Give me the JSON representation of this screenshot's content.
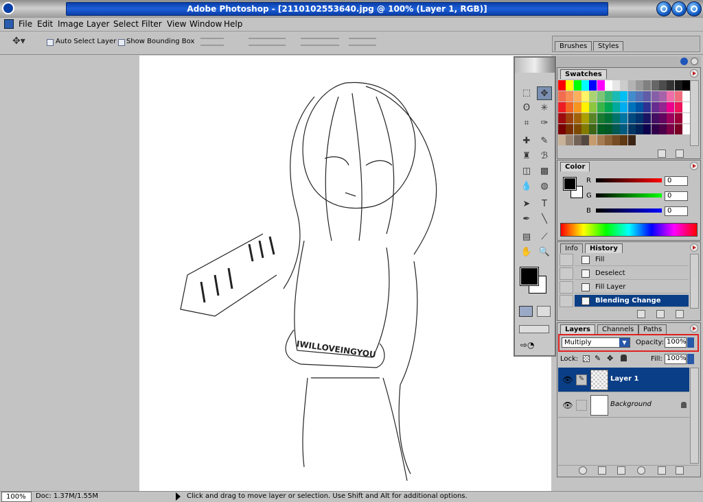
{
  "app": {
    "title": "Adobe Photoshop - [2110102553640.jpg @ 100% (Layer 1, RGB)]"
  },
  "menu": [
    "File",
    "Edit",
    "Image",
    "Layer",
    "Select",
    "Filter",
    "View",
    "Window",
    "Help"
  ],
  "options": {
    "auto_select": "Auto Select Layer",
    "bounding_box": "Show Bounding Box"
  },
  "palette_well": {
    "tabs": [
      "Brushes",
      "Styles"
    ]
  },
  "swatches": {
    "tab": "Swatches",
    "rows": [
      [
        "#ff0000",
        "#ffff00",
        "#00ff00",
        "#00ffff",
        "#0000ff",
        "#ff00ff",
        "#ffffff",
        "#e6e6e6",
        "#cccccc",
        "#b3b3b3",
        "#999999",
        "#808080",
        "#666666",
        "#4d4d4d",
        "#333333",
        "#1a1a1a",
        "#000000"
      ],
      [
        "#f26c4f",
        "#f68e55",
        "#fbaf5c",
        "#fff467",
        "#acd372",
        "#7cc576",
        "#3bb878",
        "#1abbb4",
        "#00bff3",
        "#438ccb",
        "#5574b9",
        "#605ca8",
        "#855fa8",
        "#a763a9",
        "#ef6ea8",
        "#f16d7e",
        "#ffffff"
      ],
      [
        "#ed1c24",
        "#f26522",
        "#f7941d",
        "#fff200",
        "#8dc63f",
        "#39b54a",
        "#00a651",
        "#00a99d",
        "#00aeef",
        "#0072bc",
        "#0054a6",
        "#2e3192",
        "#662d91",
        "#92278f",
        "#ec008c",
        "#ed145b",
        "#ffffff"
      ],
      [
        "#9e0b0f",
        "#a0410d",
        "#a3620a",
        "#aba000",
        "#598527",
        "#1a7b30",
        "#007236",
        "#00746b",
        "#0076a3",
        "#004a80",
        "#003471",
        "#1b1464",
        "#440e62",
        "#630460",
        "#9e005d",
        "#9e0039",
        "#ffffff"
      ],
      [
        "#790000",
        "#7b2e00",
        "#7d4900",
        "#827b00",
        "#406618",
        "#005e20",
        "#005826",
        "#005952",
        "#005b7f",
        "#003663",
        "#002157",
        "#0d004c",
        "#32004b",
        "#4b0049",
        "#7b0046",
        "#7a0026",
        "#ffffff"
      ],
      [
        "#c7b299",
        "#998675",
        "#736357",
        "#534741",
        "#c69c6d",
        "#a67c52",
        "#8c6239",
        "#754c24",
        "#603913",
        "#3c2415"
      ]
    ]
  },
  "color": {
    "tab": "Color",
    "labels": [
      "R",
      "G",
      "B"
    ],
    "values": [
      "0",
      "0",
      "0"
    ]
  },
  "history": {
    "tabs": [
      "Info",
      "History"
    ],
    "items": [
      "Fill",
      "Deselect",
      "Fill Layer",
      "Blending Change"
    ]
  },
  "layers": {
    "tabs": [
      "Layers",
      "Channels",
      "Paths"
    ],
    "blend_mode": "Multiply",
    "opacity_label": "Opacity:",
    "opacity": "100%",
    "lock_label": "Lock:",
    "fill_label": "Fill:",
    "fill": "100%",
    "items": [
      "Layer 1",
      "Background"
    ]
  },
  "canvas": {
    "shirt_text": "IWILLOVEINGYOU"
  },
  "status": {
    "zoom": "100%",
    "doc": "Doc: 1.37M/1.55M",
    "hint": "Click and drag to move layer or selection.  Use Shift and Alt for additional options."
  },
  "colors": {
    "accent": "#0a3e86",
    "highlight": "#e02020"
  }
}
